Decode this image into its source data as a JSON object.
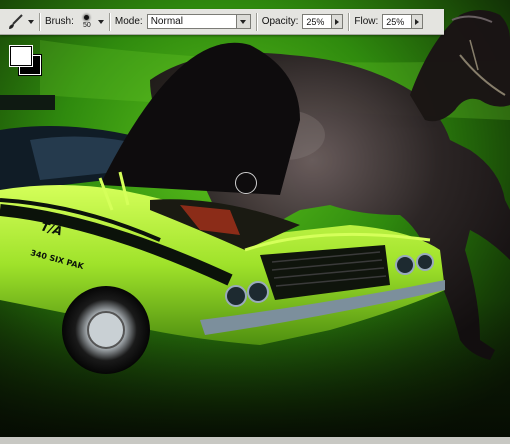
{
  "options_bar": {
    "brush_label": "Brush:",
    "brush_size": "50",
    "mode_label": "Mode:",
    "mode_value": "Normal",
    "opacity_label": "Opacity:",
    "opacity_value": "25%",
    "flow_label": "Flow:",
    "flow_value": "25%"
  },
  "icons": {
    "tool": "brush-icon",
    "dropdown": "chevron-down-icon",
    "slider": "chevron-right-icon"
  },
  "swatches": {
    "foreground_color": "#ffffff",
    "background_color": "#000000"
  },
  "image": {
    "car_decal_text": "T/A",
    "hood_text": "340 SIX PAK"
  },
  "colors": {
    "lime": "#b8f23a",
    "backdrop_green": "#3c9a12",
    "horse": "#1c1518"
  }
}
